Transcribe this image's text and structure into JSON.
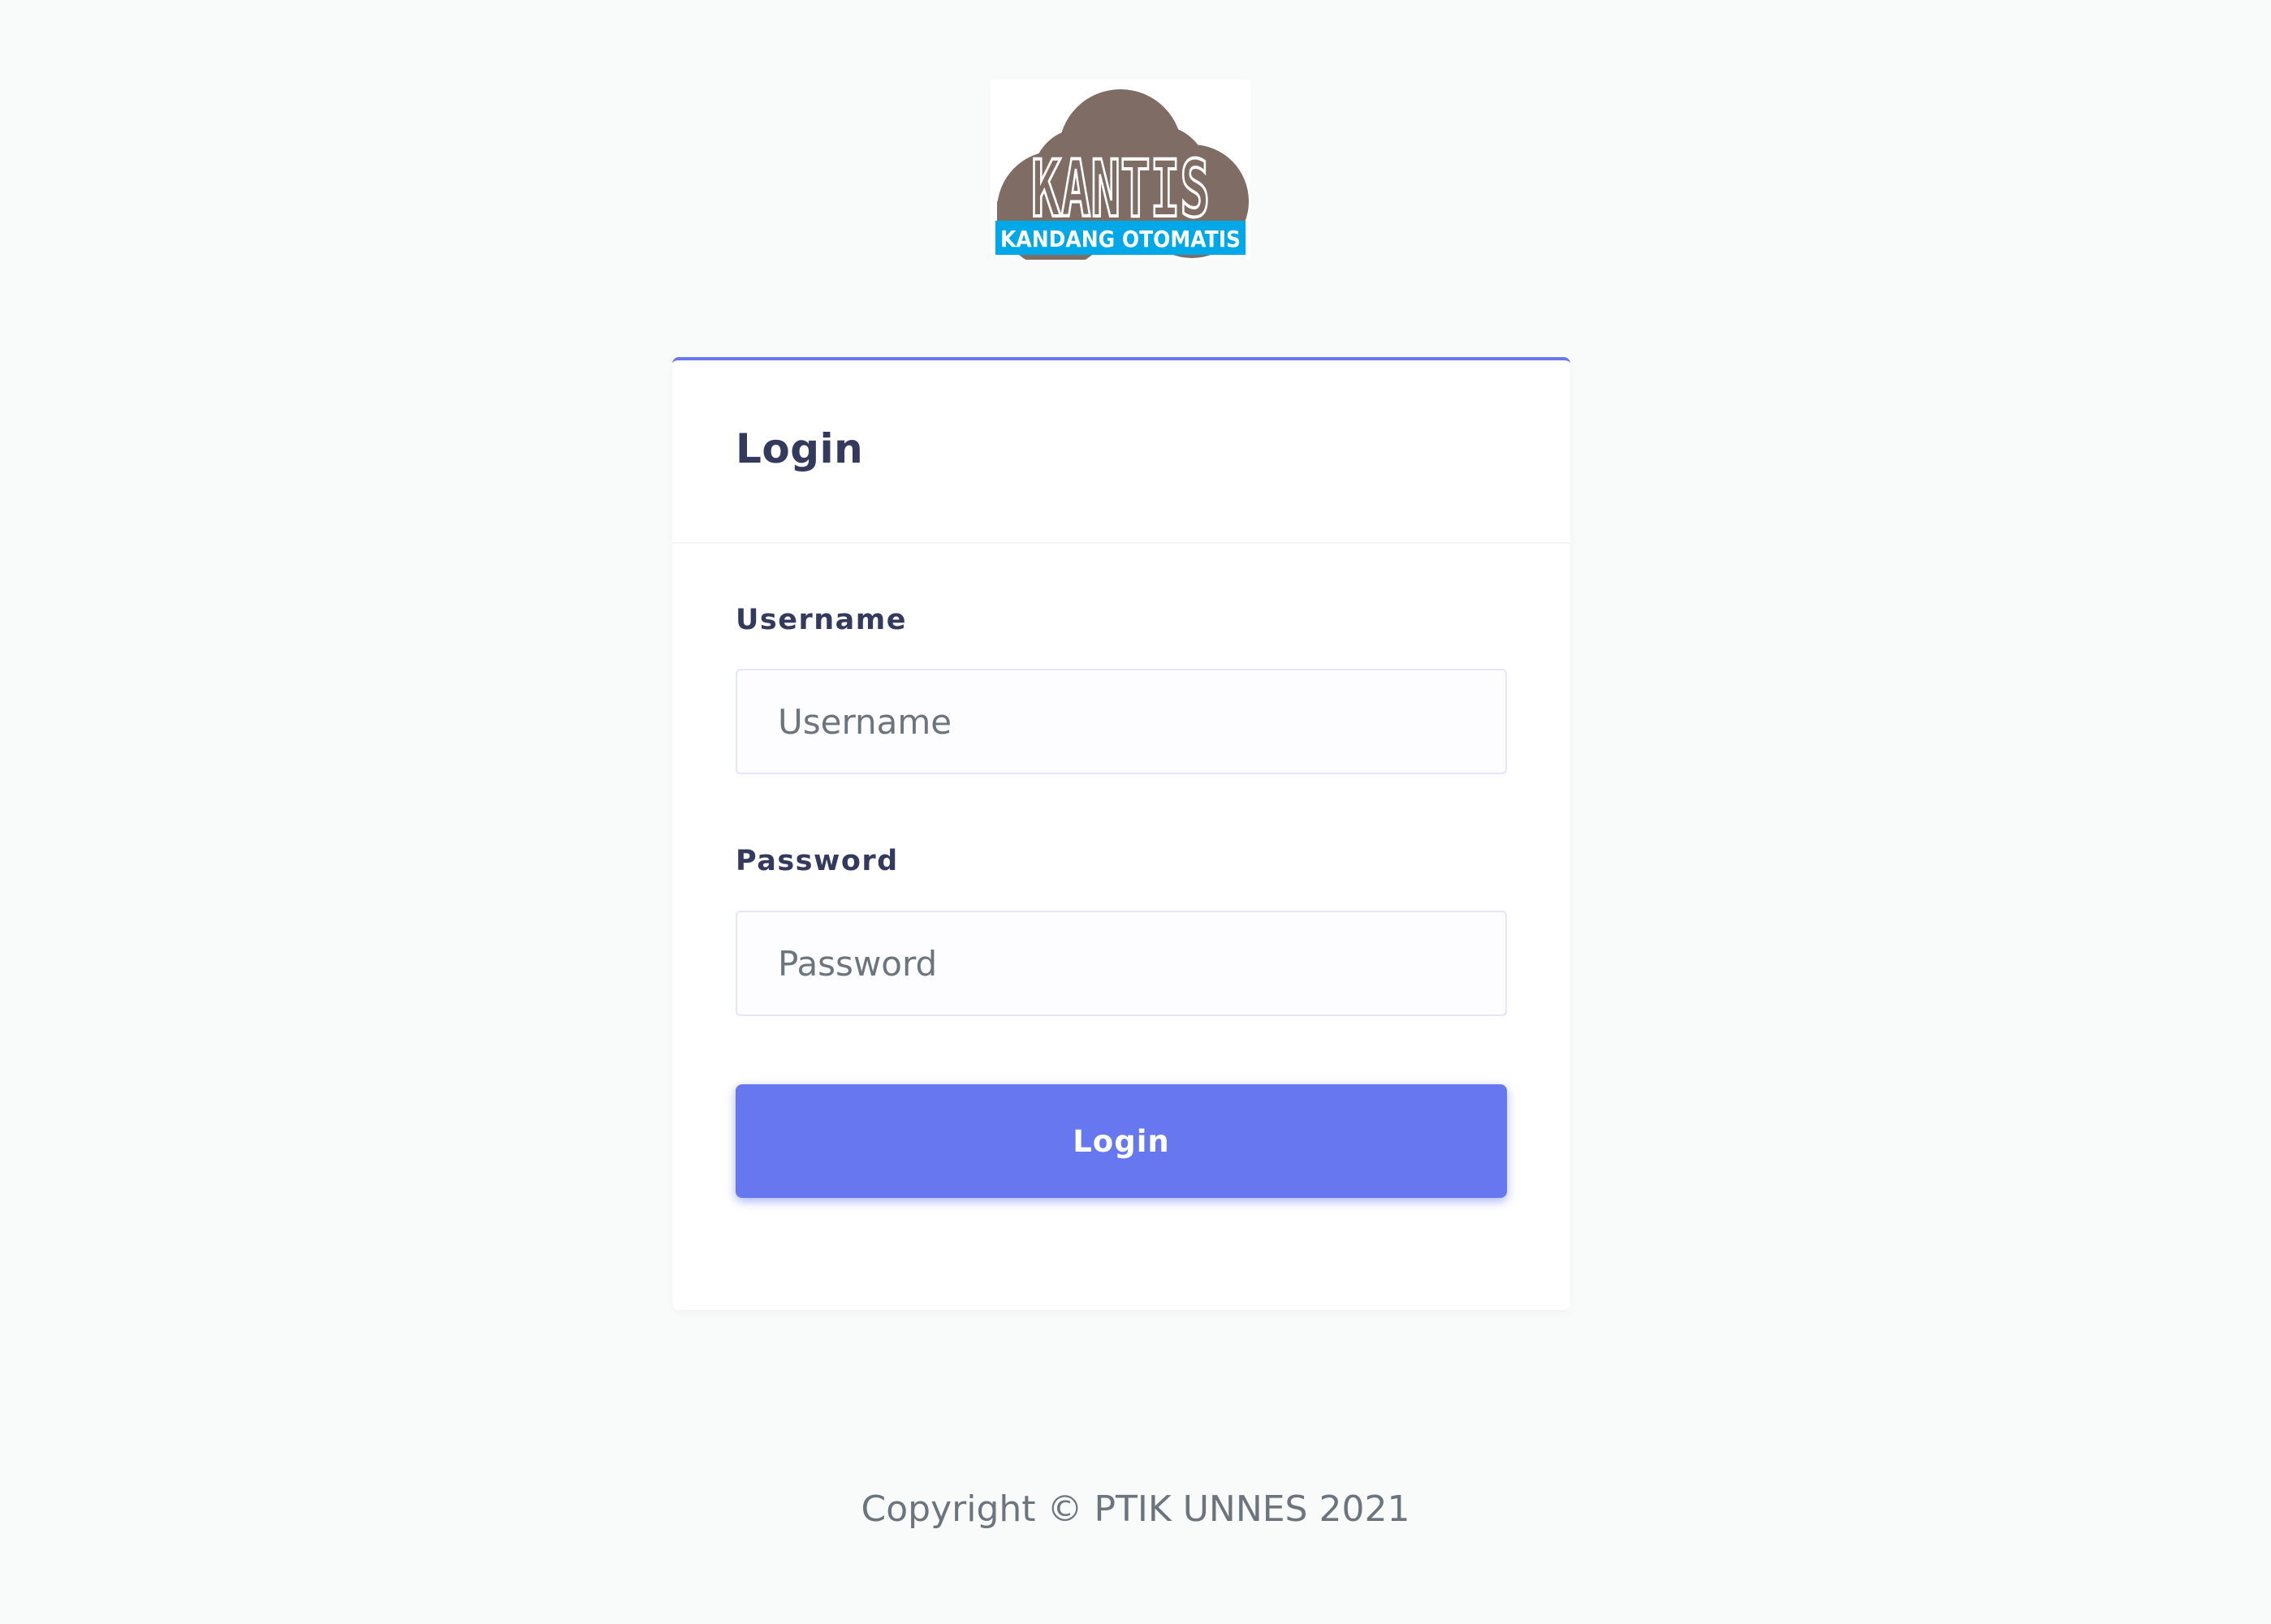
{
  "logo": {
    "title": "KANTIS",
    "subtitle": "KANDANG OTOMATIS",
    "cloud_color": "#7f6d65",
    "banner_color": "#00a8e8"
  },
  "card": {
    "title": "Login",
    "accent_color": "#6777ef"
  },
  "form": {
    "username": {
      "label": "Username",
      "placeholder": "Username",
      "value": ""
    },
    "password": {
      "label": "Password",
      "placeholder": "Password",
      "value": ""
    },
    "submit_label": "Login"
  },
  "footer": {
    "text": "Copyright © PTIK UNNES 2021"
  }
}
